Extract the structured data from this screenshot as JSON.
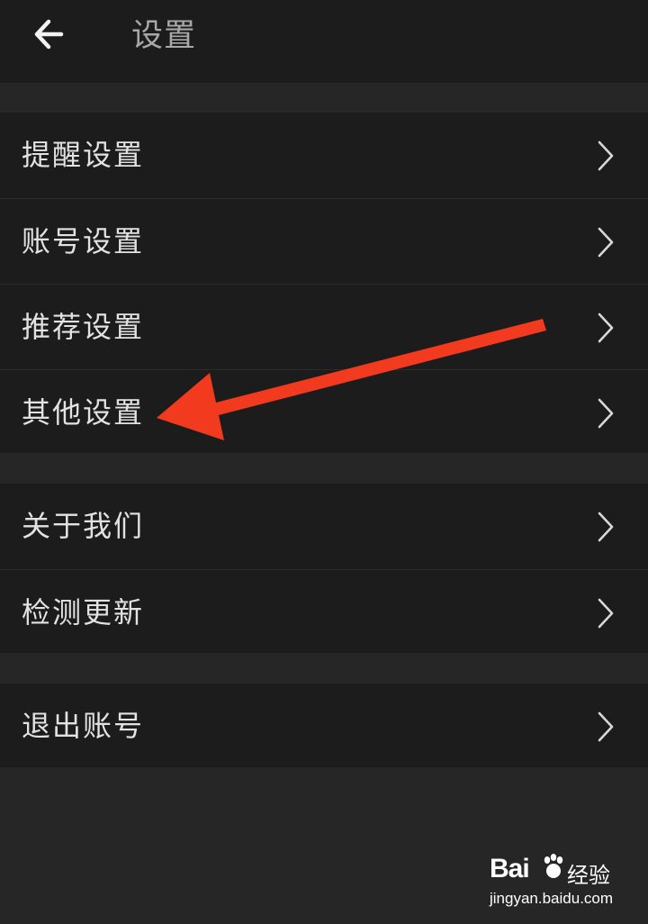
{
  "header": {
    "title": "设置",
    "back_icon": "arrow-left-icon"
  },
  "groups": [
    {
      "items": [
        {
          "label": "提醒设置"
        },
        {
          "label": "账号设置"
        },
        {
          "label": "推荐设置"
        },
        {
          "label": "其他设置"
        }
      ]
    },
    {
      "items": [
        {
          "label": "关于我们"
        },
        {
          "label": "检测更新"
        }
      ]
    },
    {
      "items": [
        {
          "label": "退出账号"
        }
      ]
    }
  ],
  "annotation": {
    "type": "arrow",
    "color": "#f23a1e",
    "points_to": "其他设置"
  },
  "watermark": {
    "brand": "Bai",
    "brand_cn": "经验",
    "url": "jingyan.baidu.com"
  },
  "colors": {
    "background": "#262626",
    "surface": "#1c1c1c",
    "text": "#e2e2e2",
    "title_text": "#a8a8a8",
    "chevron": "#d8d8d8"
  }
}
